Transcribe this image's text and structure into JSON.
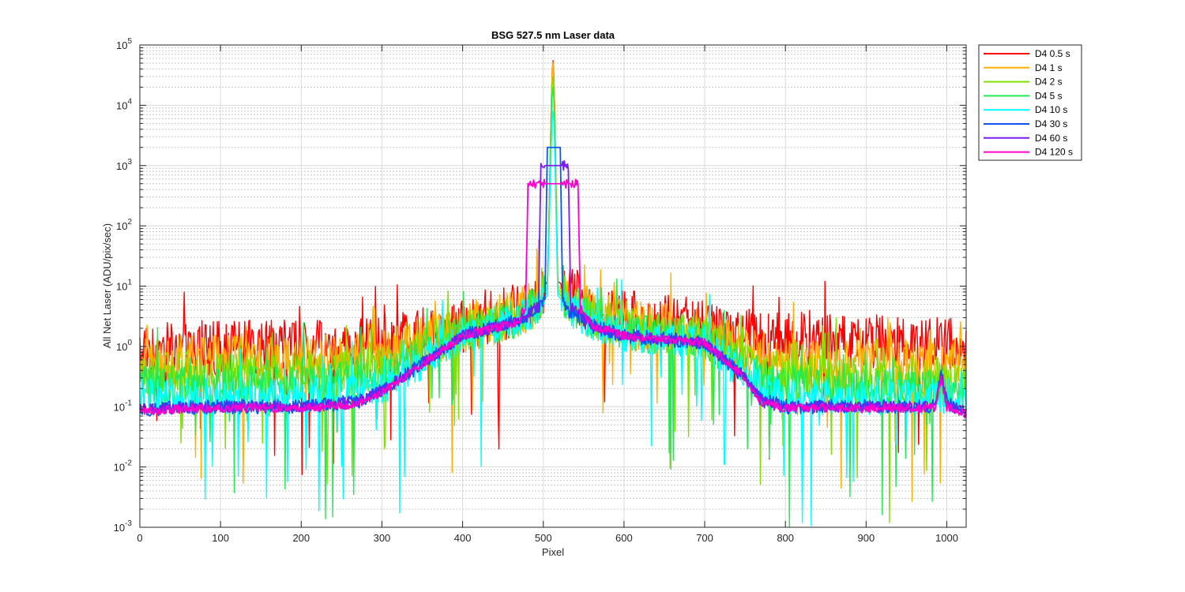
{
  "chart_data": {
    "type": "line",
    "title": "BSG  527.5 nm  Laser data",
    "xlabel": "Pixel",
    "ylabel": "All Net Laser (ADU/pix/sec)",
    "xlim": [
      0,
      1024
    ],
    "ylim": [
      0.001,
      100000
    ],
    "yscale": "log",
    "grid": true,
    "legend_position": "outside-top-right",
    "x_ticks": [
      0,
      100,
      200,
      300,
      400,
      500,
      600,
      700,
      800,
      900,
      1000
    ],
    "y_ticks": [
      {
        "value": 0.001,
        "base": "10",
        "exp": "-3"
      },
      {
        "value": 0.01,
        "base": "10",
        "exp": "-2"
      },
      {
        "value": 0.1,
        "base": "10",
        "exp": "-1"
      },
      {
        "value": 1,
        "base": "10",
        "exp": "0"
      },
      {
        "value": 10,
        "base": "10",
        "exp": "1"
      },
      {
        "value": 100,
        "base": "10",
        "exp": "2"
      },
      {
        "value": 1000,
        "base": "10",
        "exp": "3"
      },
      {
        "value": 10000,
        "base": "10",
        "exp": "4"
      },
      {
        "value": 100000,
        "base": "10",
        "exp": "5"
      }
    ],
    "series": [
      {
        "name": "D4 0.5 s",
        "color": "#ff0000",
        "peak": 55000,
        "baseline": 0.9,
        "noise": 0.75,
        "dips": 0.015,
        "profile": [
          [
            0,
            0.9
          ],
          [
            100,
            0.95
          ],
          [
            200,
            1.0
          ],
          [
            300,
            1.1
          ],
          [
            400,
            2.2
          ],
          [
            470,
            4.0
          ],
          [
            495,
            7.0
          ],
          [
            505,
            12
          ],
          [
            512,
            55000
          ],
          [
            518,
            12
          ],
          [
            530,
            9
          ],
          [
            560,
            4.5
          ],
          [
            600,
            3.2
          ],
          [
            700,
            2.2
          ],
          [
            760,
            1.5
          ],
          [
            800,
            1.3
          ],
          [
            900,
            1.2
          ],
          [
            1000,
            1.1
          ],
          [
            1024,
            1.0
          ]
        ]
      },
      {
        "name": "D4 1 s",
        "color": "#ffb000",
        "peak": 52000,
        "baseline": 0.55,
        "noise": 0.7,
        "dips": 0.02,
        "profile": [
          [
            0,
            0.55
          ],
          [
            100,
            0.6
          ],
          [
            200,
            0.6
          ],
          [
            300,
            0.7
          ],
          [
            400,
            2.0
          ],
          [
            470,
            3.5
          ],
          [
            495,
            6
          ],
          [
            505,
            10
          ],
          [
            512,
            52000
          ],
          [
            518,
            10
          ],
          [
            530,
            7
          ],
          [
            560,
            3.5
          ],
          [
            600,
            2.5
          ],
          [
            700,
            1.6
          ],
          [
            760,
            0.8
          ],
          [
            800,
            0.55
          ],
          [
            900,
            0.5
          ],
          [
            1000,
            0.5
          ],
          [
            1024,
            0.55
          ]
        ]
      },
      {
        "name": "D4 2 s",
        "color": "#80e000",
        "peak": 30000,
        "baseline": 0.35,
        "noise": 0.6,
        "dips": 0.025,
        "profile": [
          [
            0,
            0.35
          ],
          [
            100,
            0.35
          ],
          [
            200,
            0.38
          ],
          [
            300,
            0.45
          ],
          [
            400,
            1.8
          ],
          [
            470,
            3.2
          ],
          [
            495,
            5.5
          ],
          [
            505,
            9
          ],
          [
            512,
            30000
          ],
          [
            518,
            9
          ],
          [
            530,
            6
          ],
          [
            560,
            3.0
          ],
          [
            600,
            2.0
          ],
          [
            700,
            1.4
          ],
          [
            760,
            0.5
          ],
          [
            800,
            0.35
          ],
          [
            900,
            0.3
          ],
          [
            1000,
            0.3
          ],
          [
            1024,
            0.35
          ]
        ]
      },
      {
        "name": "D4 5 s",
        "color": "#22ea55",
        "peak": 20000,
        "baseline": 0.22,
        "noise": 0.55,
        "dips": 0.03,
        "profile": [
          [
            0,
            0.22
          ],
          [
            100,
            0.22
          ],
          [
            200,
            0.24
          ],
          [
            300,
            0.3
          ],
          [
            400,
            1.7
          ],
          [
            470,
            3.0
          ],
          [
            495,
            5
          ],
          [
            505,
            8
          ],
          [
            512,
            20000
          ],
          [
            518,
            8
          ],
          [
            530,
            5
          ],
          [
            560,
            2.8
          ],
          [
            600,
            1.8
          ],
          [
            700,
            1.3
          ],
          [
            760,
            0.35
          ],
          [
            800,
            0.22
          ],
          [
            900,
            0.2
          ],
          [
            1000,
            0.2
          ],
          [
            1024,
            0.22
          ]
        ]
      },
      {
        "name": "D4 10 s",
        "color": "#00ffff",
        "peak": 8000,
        "baseline": 0.15,
        "noise": 0.5,
        "dips": 0.03,
        "profile": [
          [
            0,
            0.15
          ],
          [
            100,
            0.15
          ],
          [
            200,
            0.16
          ],
          [
            300,
            0.2
          ],
          [
            400,
            1.6
          ],
          [
            470,
            2.8
          ],
          [
            495,
            4.5
          ],
          [
            505,
            7
          ],
          [
            512,
            8000
          ],
          [
            518,
            7
          ],
          [
            530,
            4.5
          ],
          [
            560,
            2.5
          ],
          [
            600,
            1.6
          ],
          [
            700,
            1.2
          ],
          [
            760,
            0.25
          ],
          [
            800,
            0.15
          ],
          [
            900,
            0.14
          ],
          [
            1000,
            0.15
          ],
          [
            1024,
            0.15
          ]
        ]
      },
      {
        "name": "D4 30 s",
        "color": "#0d55f0",
        "peak": 2000,
        "baseline": 0.09,
        "noise": 0.2,
        "dips": 0,
        "plateau": [
          502,
          524,
          2000
        ],
        "profile": [
          [
            0,
            0.09
          ],
          [
            100,
            0.1
          ],
          [
            200,
            0.1
          ],
          [
            270,
            0.12
          ],
          [
            300,
            0.18
          ],
          [
            400,
            1.5
          ],
          [
            470,
            2.7
          ],
          [
            495,
            4.5
          ],
          [
            500,
            6
          ],
          [
            526,
            6
          ],
          [
            530,
            4
          ],
          [
            560,
            2.2
          ],
          [
            600,
            1.5
          ],
          [
            700,
            1.15
          ],
          [
            750,
            0.3
          ],
          [
            770,
            0.13
          ],
          [
            800,
            0.1
          ],
          [
            900,
            0.1
          ],
          [
            985,
            0.1
          ],
          [
            993,
            0.35
          ],
          [
            1000,
            0.12
          ],
          [
            1024,
            0.08
          ]
        ]
      },
      {
        "name": "D4 60 s",
        "color": "#7a1ef0",
        "peak": 1000,
        "baseline": 0.09,
        "noise": 0.15,
        "dips": 0,
        "plateau": [
          494,
          534,
          1000
        ],
        "profile": [
          [
            0,
            0.09
          ],
          [
            100,
            0.1
          ],
          [
            200,
            0.1
          ],
          [
            270,
            0.12
          ],
          [
            300,
            0.18
          ],
          [
            400,
            1.5
          ],
          [
            470,
            2.6
          ],
          [
            490,
            4.5
          ],
          [
            538,
            4.5
          ],
          [
            560,
            2.2
          ],
          [
            600,
            1.5
          ],
          [
            700,
            1.15
          ],
          [
            750,
            0.3
          ],
          [
            770,
            0.13
          ],
          [
            800,
            0.1
          ],
          [
            900,
            0.1
          ],
          [
            985,
            0.1
          ],
          [
            993,
            0.3
          ],
          [
            1000,
            0.11
          ],
          [
            1024,
            0.08
          ]
        ]
      },
      {
        "name": "D4 120 s",
        "color": "#ff00cc",
        "peak": 500,
        "baseline": 0.085,
        "noise": 0.12,
        "dips": 0,
        "plateau": [
          478,
          546,
          500
        ],
        "profile": [
          [
            0,
            0.085
          ],
          [
            100,
            0.095
          ],
          [
            200,
            0.095
          ],
          [
            270,
            0.11
          ],
          [
            300,
            0.17
          ],
          [
            400,
            1.5
          ],
          [
            470,
            2.6
          ],
          [
            474,
            4
          ],
          [
            550,
            4
          ],
          [
            560,
            2.2
          ],
          [
            600,
            1.5
          ],
          [
            700,
            1.15
          ],
          [
            750,
            0.3
          ],
          [
            770,
            0.12
          ],
          [
            800,
            0.095
          ],
          [
            900,
            0.095
          ],
          [
            985,
            0.095
          ],
          [
            993,
            0.3
          ],
          [
            1000,
            0.1
          ],
          [
            1024,
            0.075
          ]
        ]
      }
    ]
  }
}
